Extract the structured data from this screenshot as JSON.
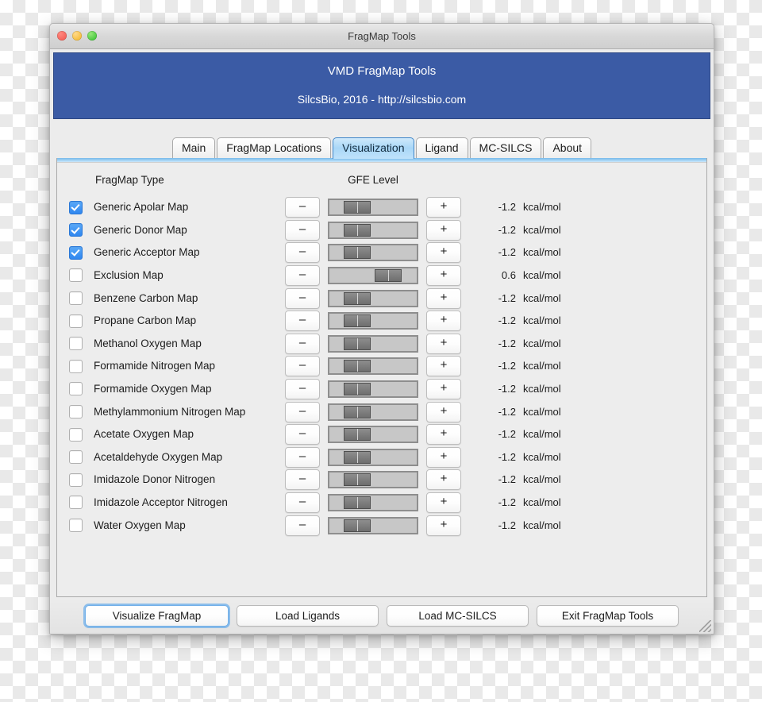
{
  "window": {
    "title": "FragMap Tools",
    "traffic_lights": [
      "close-button",
      "minimize-button",
      "zoom-button"
    ]
  },
  "banner": {
    "line1": "VMD FragMap Tools",
    "line2": "SilcsBio, 2016 - http://silcsbio.com",
    "color": "#3b5ba5"
  },
  "tabs": [
    {
      "label": "Main",
      "active": false
    },
    {
      "label": "FragMap Locations",
      "active": false
    },
    {
      "label": "Visualization",
      "active": true
    },
    {
      "label": "Ligand",
      "active": false
    },
    {
      "label": "MC-SILCS",
      "active": false
    },
    {
      "label": "About",
      "active": false
    }
  ],
  "table": {
    "headers": {
      "type": "FragMap Type",
      "gfe": "GFE Level"
    },
    "decrement_label": "–",
    "increment_label": "+",
    "rows": [
      {
        "label": "Generic Apolar Map",
        "checked": true,
        "value": "-1.2",
        "unit": "kcal/mol",
        "thumb_pct": 16
      },
      {
        "label": "Generic Donor Map",
        "checked": true,
        "value": "-1.2",
        "unit": "kcal/mol",
        "thumb_pct": 16
      },
      {
        "label": "Generic Acceptor Map",
        "checked": true,
        "value": "-1.2",
        "unit": "kcal/mol",
        "thumb_pct": 16
      },
      {
        "label": "Exclusion Map",
        "checked": false,
        "value": "0.6",
        "unit": "kcal/mol",
        "thumb_pct": 52
      },
      {
        "label": "Benzene Carbon Map",
        "checked": false,
        "value": "-1.2",
        "unit": "kcal/mol",
        "thumb_pct": 16
      },
      {
        "label": "Propane Carbon Map",
        "checked": false,
        "value": "-1.2",
        "unit": "kcal/mol",
        "thumb_pct": 16
      },
      {
        "label": "Methanol Oxygen Map",
        "checked": false,
        "value": "-1.2",
        "unit": "kcal/mol",
        "thumb_pct": 16
      },
      {
        "label": "Formamide Nitrogen Map",
        "checked": false,
        "value": "-1.2",
        "unit": "kcal/mol",
        "thumb_pct": 16
      },
      {
        "label": "Formamide Oxygen Map",
        "checked": false,
        "value": "-1.2",
        "unit": "kcal/mol",
        "thumb_pct": 16
      },
      {
        "label": "Methylammonium Nitrogen Map",
        "checked": false,
        "value": "-1.2",
        "unit": "kcal/mol",
        "thumb_pct": 16
      },
      {
        "label": "Acetate Oxygen Map",
        "checked": false,
        "value": "-1.2",
        "unit": "kcal/mol",
        "thumb_pct": 16
      },
      {
        "label": "Acetaldehyde Oxygen Map",
        "checked": false,
        "value": "-1.2",
        "unit": "kcal/mol",
        "thumb_pct": 16
      },
      {
        "label": "Imidazole Donor Nitrogen",
        "checked": false,
        "value": "-1.2",
        "unit": "kcal/mol",
        "thumb_pct": 16
      },
      {
        "label": "Imidazole Acceptor Nitrogen",
        "checked": false,
        "value": "-1.2",
        "unit": "kcal/mol",
        "thumb_pct": 16
      },
      {
        "label": "Water Oxygen Map",
        "checked": false,
        "value": "-1.2",
        "unit": "kcal/mol",
        "thumb_pct": 16
      }
    ]
  },
  "toolbar": {
    "buttons": [
      {
        "label": "Visualize FragMap",
        "focused": true
      },
      {
        "label": "Load Ligands",
        "focused": false
      },
      {
        "label": "Load MC-SILCS",
        "focused": false
      },
      {
        "label": "Exit FragMap Tools",
        "focused": false
      }
    ]
  }
}
